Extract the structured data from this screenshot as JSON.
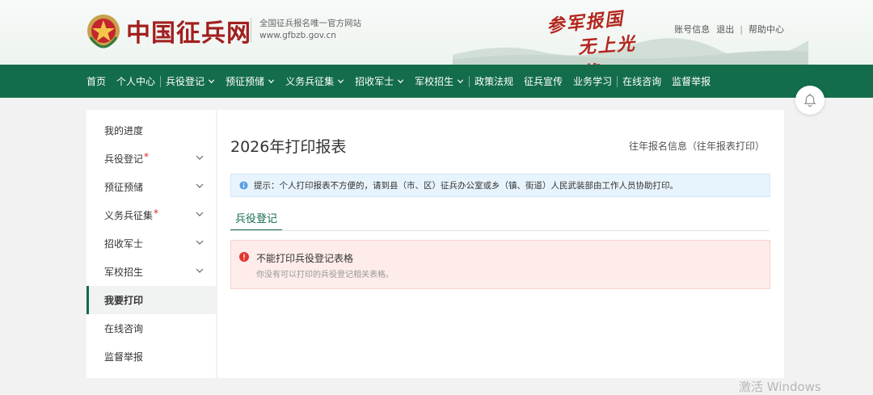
{
  "header": {
    "site_title": "中国征兵网",
    "subtitle_line1": "全国征兵报名唯一官方网站",
    "subtitle_line2": "www.gfbzb.gov.cn",
    "slogan_line1": "参军报国",
    "slogan_line2": "无上光荣",
    "links": {
      "account": "账号信息",
      "logout": "退出",
      "help": "帮助中心",
      "separator": "|"
    }
  },
  "nav": {
    "items": [
      {
        "label": "首页"
      },
      {
        "label": "个人中心"
      },
      {
        "label": "兵役登记"
      },
      {
        "label": "预征预储"
      },
      {
        "label": "义务兵征集"
      },
      {
        "label": "招收军士"
      },
      {
        "label": "军校招生"
      },
      {
        "label": "政策法规"
      },
      {
        "label": "征兵宣传"
      },
      {
        "label": "业务学习"
      },
      {
        "label": "在线咨询"
      },
      {
        "label": "监督举报"
      }
    ],
    "dropdown_icon": "chevron-down-icon"
  },
  "sidebar": {
    "items": [
      {
        "label": "我的进度"
      },
      {
        "label": "兵役登记",
        "star": "*"
      },
      {
        "label": "预征预储"
      },
      {
        "label": "义务兵征集",
        "star": "*"
      },
      {
        "label": "招收军士"
      },
      {
        "label": "军校招生"
      },
      {
        "label": "我要打印"
      },
      {
        "label": "在线咨询"
      },
      {
        "label": "监督举报"
      }
    ],
    "active_index": 6
  },
  "main": {
    "title": "2026年打印报表",
    "history_link": "往年报名信息（往年报表打印）",
    "tip": "提示：个人打印报表不方便的，请到县（市、区）征兵办公室或乡（镇、街道）人民武装部由工作人员协助打印。",
    "tab": "兵役登记",
    "alert_title": "不能打印兵役登记表格",
    "alert_desc": "你没有可以打印的兵役登记相关表格。"
  },
  "watermark": "激活 Windows",
  "colors": {
    "brand_green": "#136d4a",
    "brand_red": "#a11f1f",
    "tip_bg": "#e8f4fd",
    "alert_bg": "#fdecea",
    "alert_icon": "#e5352f",
    "info_icon": "#5b9fe3"
  }
}
